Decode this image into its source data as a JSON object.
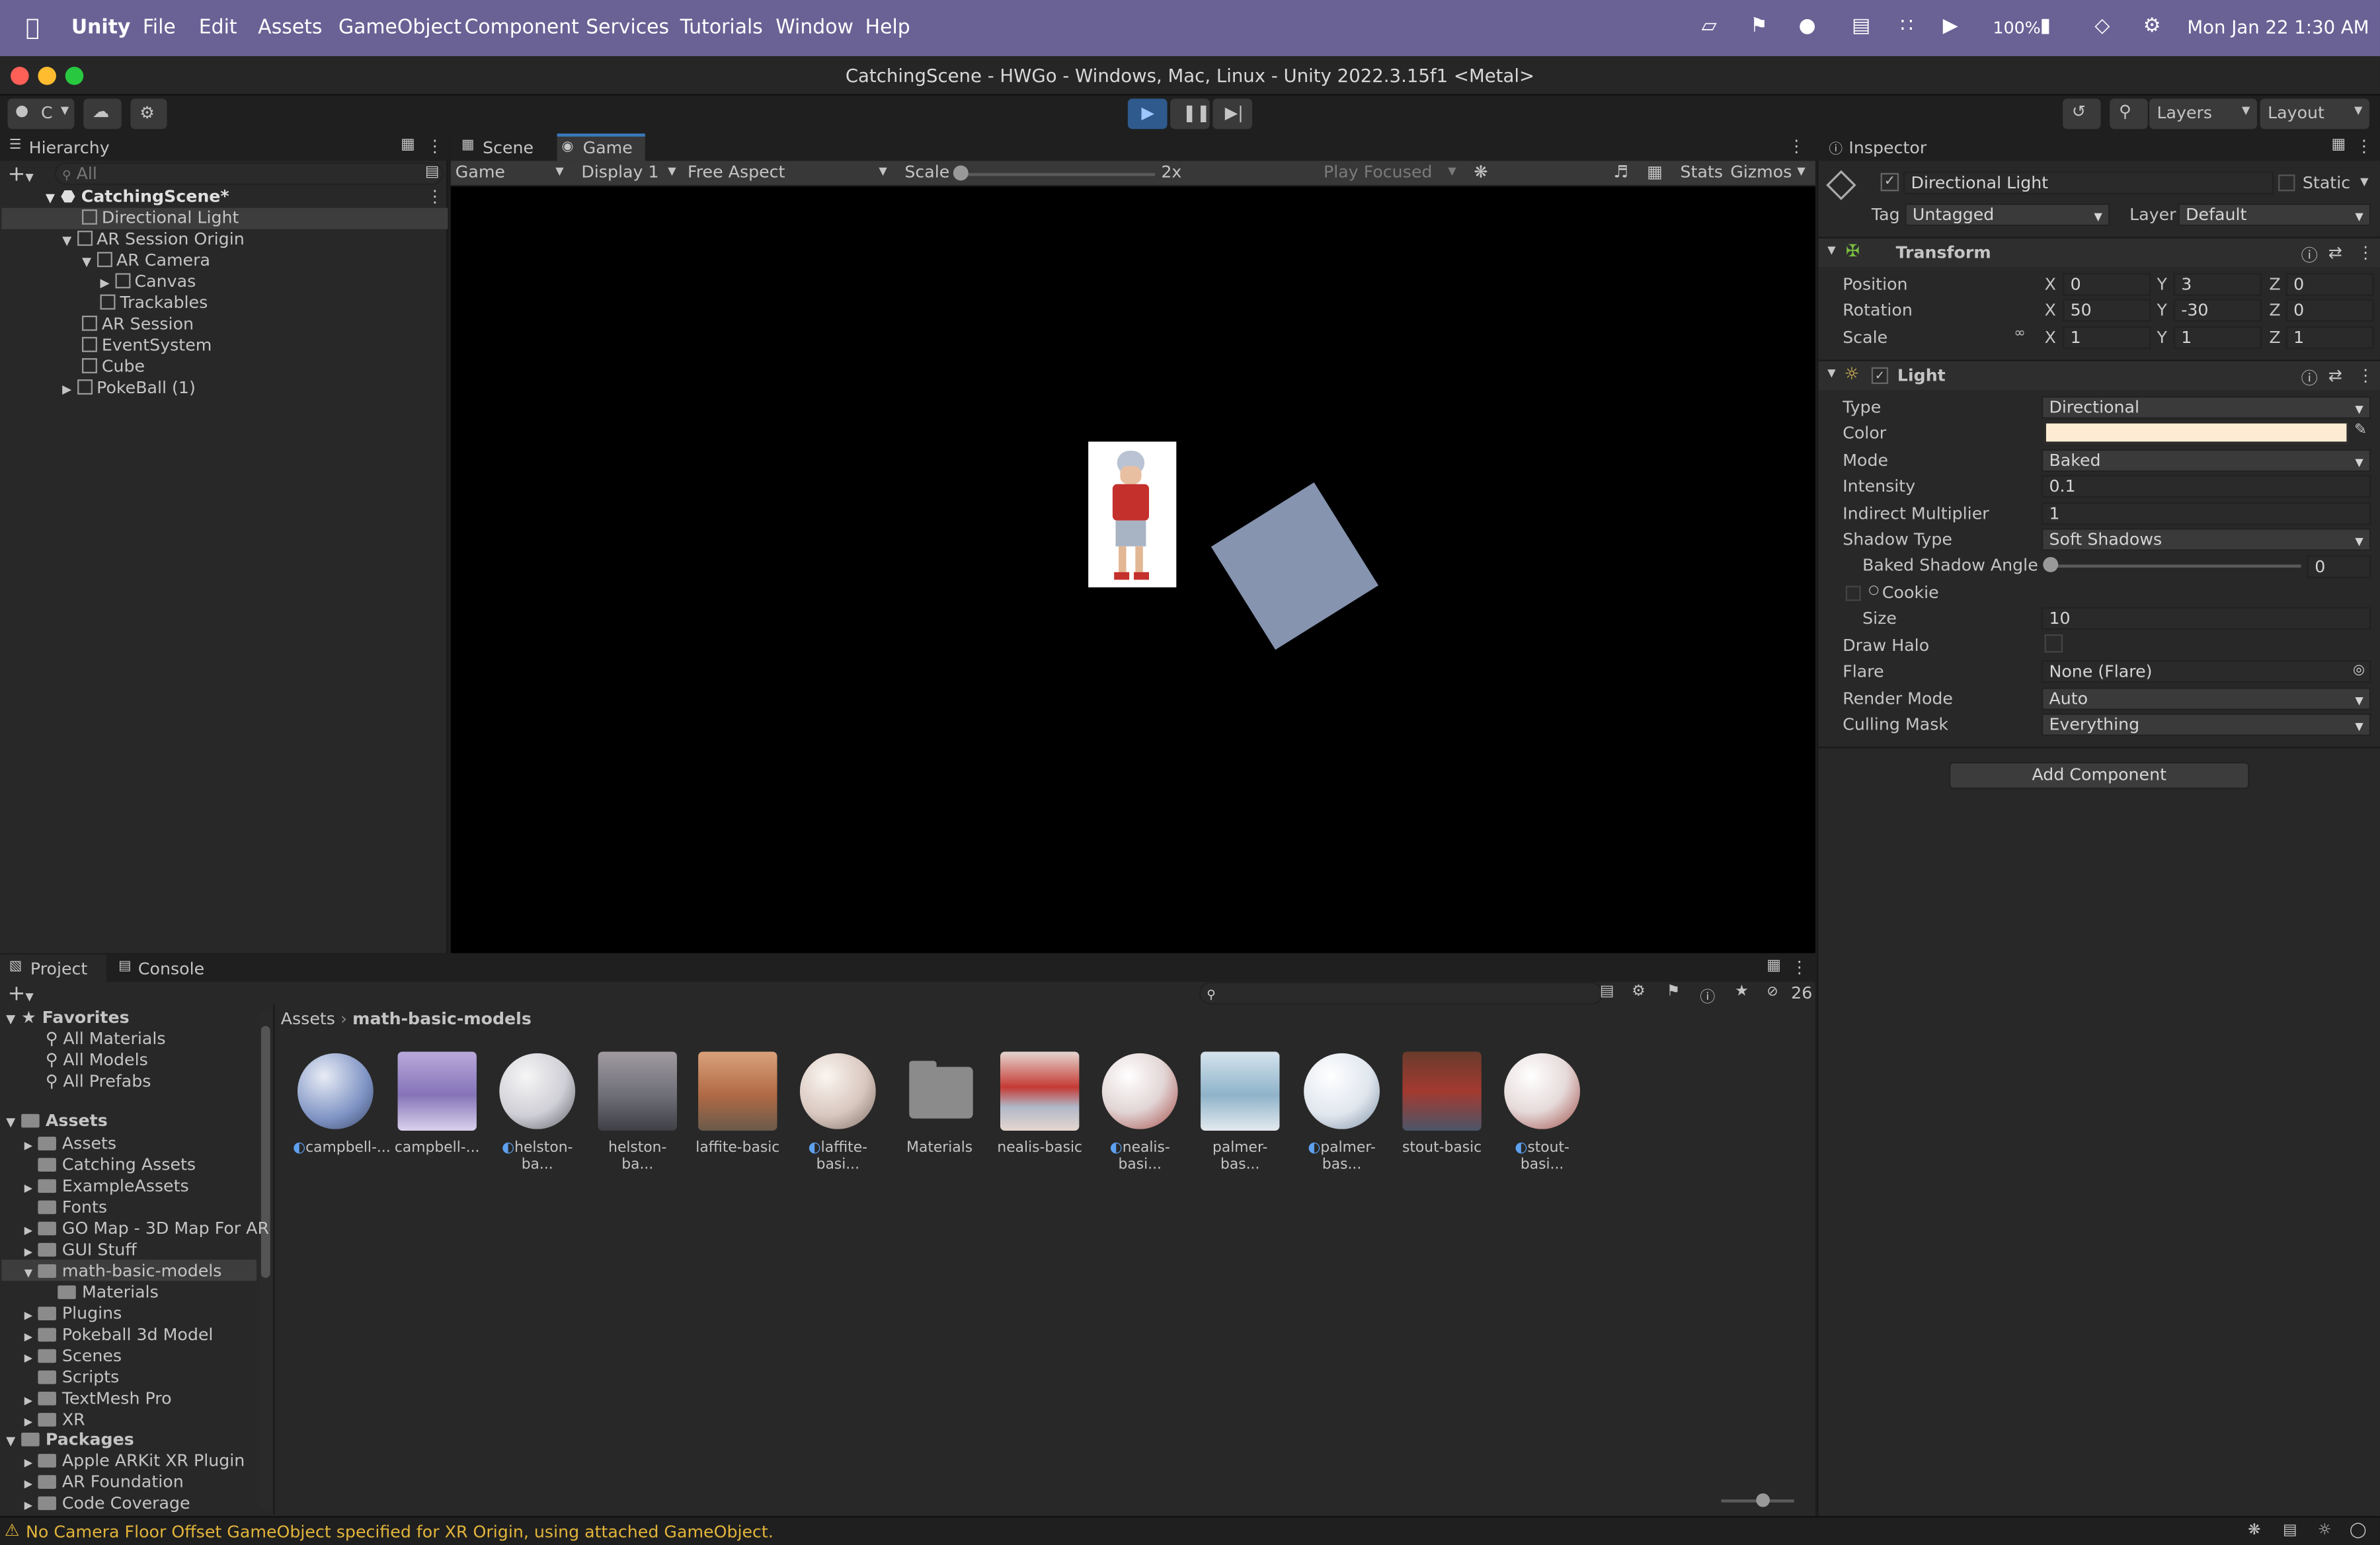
{
  "menubar": {
    "app": "Unity",
    "items": [
      "File",
      "Edit",
      "Assets",
      "GameObject",
      "Component",
      "Services",
      "Tutorials",
      "Window",
      "Help"
    ],
    "battery": "100%",
    "datetime": "Mon Jan 22  1:30 AM"
  },
  "window": {
    "title": "CatchingScene - HWGo - Windows, Mac, Linux - Unity 2022.3.15f1 <Metal>"
  },
  "toolbar": {
    "account_label": "C",
    "layers_label": "Layers",
    "layout_label": "Layout"
  },
  "hierarchy": {
    "tab": "Hierarchy",
    "search_placeholder": "All",
    "scene": "CatchingScene*",
    "items": [
      {
        "label": "Directional Light"
      },
      {
        "label": "AR Session Origin"
      },
      {
        "label": "AR Camera"
      },
      {
        "label": "Canvas"
      },
      {
        "label": "Trackables"
      },
      {
        "label": "AR Session"
      },
      {
        "label": "EventSystem"
      },
      {
        "label": "Cube"
      },
      {
        "label": "PokeBall (1)"
      }
    ]
  },
  "game_view": {
    "tabs": [
      "Scene",
      "Game"
    ],
    "view_select": "Game",
    "display": "Display 1",
    "aspect": "Free Aspect",
    "scale_label": "Scale",
    "scale_value": "2x",
    "play_focused": "Play Focused",
    "stats": "Stats",
    "gizmos": "Gizmos"
  },
  "inspector": {
    "tab": "Inspector",
    "object_name": "Directional Light",
    "static_label": "Static",
    "tag_label": "Tag",
    "tag_value": "Untagged",
    "layer_label": "Layer",
    "layer_value": "Default",
    "transform": {
      "title": "Transform",
      "position_label": "Position",
      "rotation_label": "Rotation",
      "scale_label": "Scale",
      "position": {
        "x": "0",
        "y": "3",
        "z": "0"
      },
      "rotation": {
        "x": "50",
        "y": "-30",
        "z": "0"
      },
      "scale": {
        "x": "1",
        "y": "1",
        "z": "1"
      }
    },
    "light": {
      "title": "Light",
      "type_label": "Type",
      "type": "Directional",
      "color_label": "Color",
      "color": "#fdecd3",
      "mode_label": "Mode",
      "mode": "Baked",
      "intensity_label": "Intensity",
      "intensity": "0.1",
      "indirect_label": "Indirect Multiplier",
      "indirect": "1",
      "shadow_label": "Shadow Type",
      "shadow": "Soft Shadows",
      "baked_angle_label": "Baked Shadow Angle",
      "baked_angle": "0",
      "cookie_label": "Cookie",
      "size_label": "Size",
      "size": "10",
      "halo_label": "Draw Halo",
      "flare_label": "Flare",
      "flare": "None (Flare)",
      "render_label": "Render Mode",
      "render": "Auto",
      "culling_label": "Culling Mask",
      "culling": "Everything"
    },
    "add_component": "Add Component"
  },
  "project": {
    "tabs": [
      "Project",
      "Console"
    ],
    "count": "26",
    "breadcrumb": [
      "Assets",
      "math-basic-models"
    ],
    "favorites_title": "Favorites",
    "favorites": [
      "All Materials",
      "All Models",
      "All Prefabs"
    ],
    "assets_title": "Assets",
    "assets_folders": [
      "Assets",
      "Catching Assets",
      "ExampleAssets",
      "Fonts",
      "GO Map - 3D Map For AR",
      "GUI Stuff",
      "math-basic-models",
      "Materials",
      "Plugins",
      "Pokeball 3d Model",
      "Scenes",
      "Scripts",
      "TextMesh Pro",
      "XR"
    ],
    "packages_title": "Packages",
    "packages": [
      "Apple ARKit XR Plugin",
      "AR Foundation",
      "Code Coverage"
    ],
    "grid": [
      {
        "label": "campbell-...",
        "kind": "material",
        "color": "#7e93c4"
      },
      {
        "label": "campbell-...",
        "kind": "model",
        "color": "#9d8fc6"
      },
      {
        "label": "helston-ba...",
        "kind": "material",
        "color": "#cfcfd6"
      },
      {
        "label": "helston-ba...",
        "kind": "model",
        "color": "#6f6f78"
      },
      {
        "label": "laffite-basic",
        "kind": "model",
        "color": "#b06a45"
      },
      {
        "label": "laffite-basi...",
        "kind": "material",
        "color": "#d8c7bf"
      },
      {
        "label": "Materials",
        "kind": "folder",
        "color": "#8b8b8b"
      },
      {
        "label": "nealis-basic",
        "kind": "model",
        "color": "#c53a34"
      },
      {
        "label": "nealis-basi...",
        "kind": "material",
        "color": "#e2d5d5"
      },
      {
        "label": "palmer-bas...",
        "kind": "model",
        "color": "#8fb3c9"
      },
      {
        "label": "palmer-bas...",
        "kind": "material",
        "color": "#e0e6ee"
      },
      {
        "label": "stout-basic",
        "kind": "model",
        "color": "#a33a30"
      },
      {
        "label": "stout-basi...",
        "kind": "material",
        "color": "#e6dada"
      }
    ]
  },
  "status": {
    "message": "No Camera Floor Offset GameObject specified for XR Origin, using attached GameObject."
  }
}
